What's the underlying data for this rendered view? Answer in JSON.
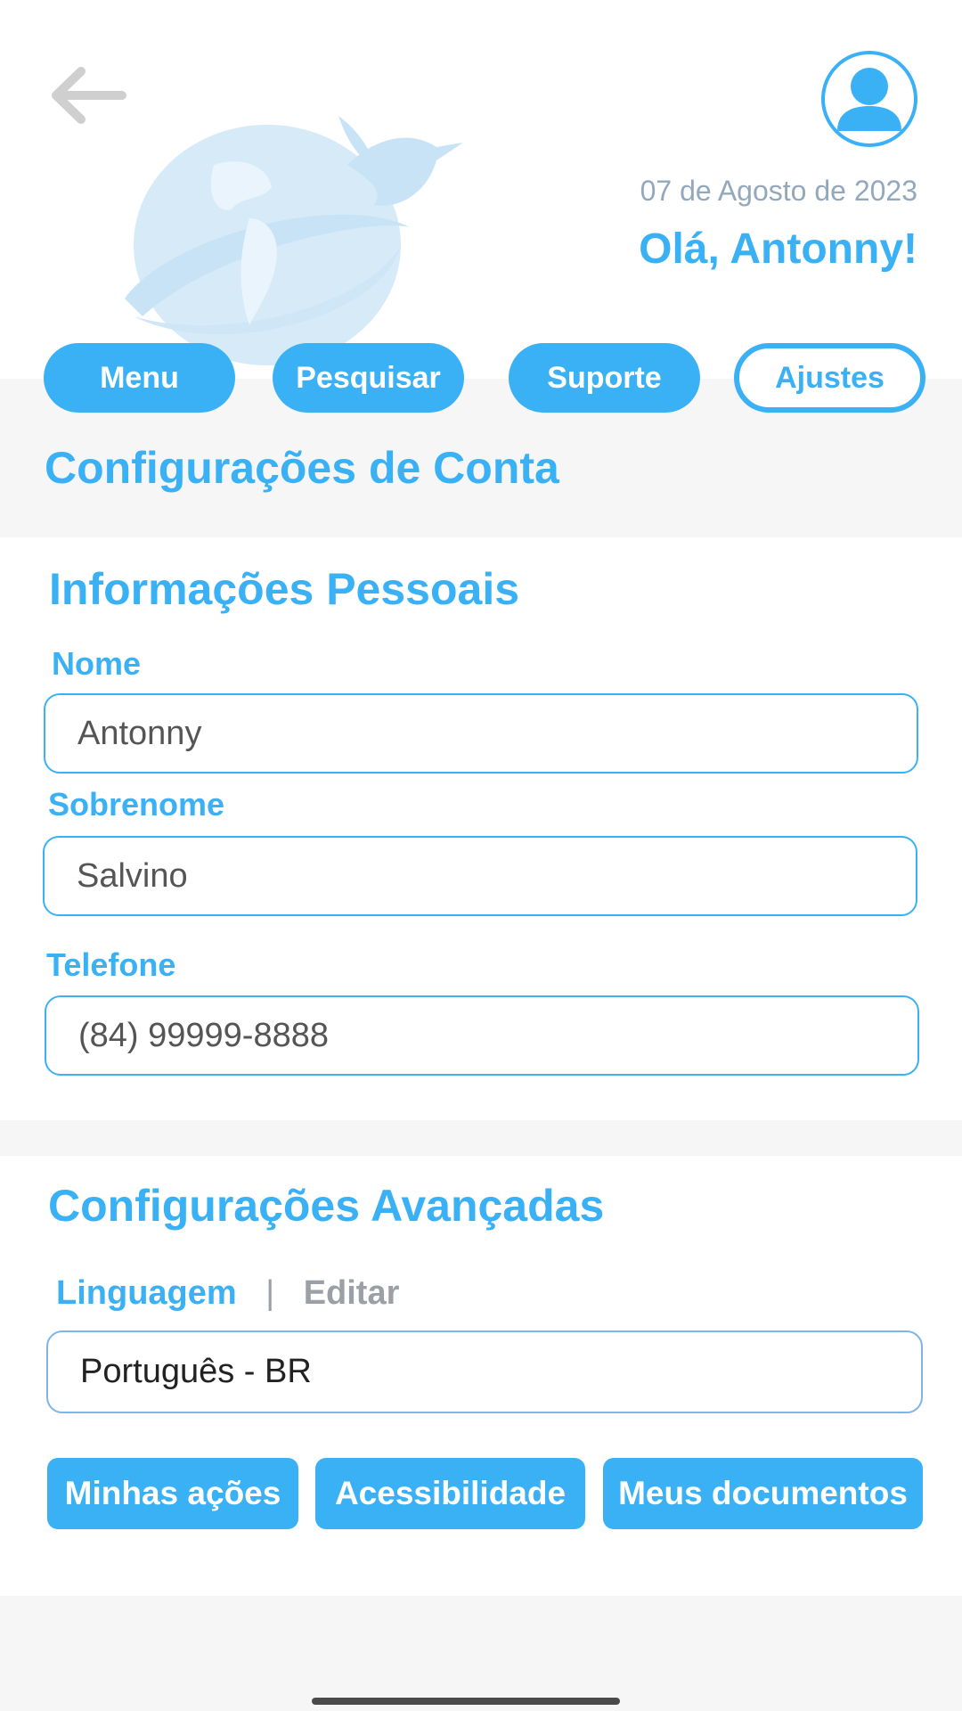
{
  "header": {
    "date": "07 de Agosto de 2023",
    "greeting": "Olá, Antonny!"
  },
  "nav": {
    "items": [
      {
        "label": "Menu",
        "active": false
      },
      {
        "label": "Pesquisar",
        "active": false
      },
      {
        "label": "Suporte",
        "active": false
      },
      {
        "label": "Ajustes",
        "active": true
      }
    ]
  },
  "page": {
    "title": "Configurações de Conta"
  },
  "personal": {
    "title": "Informações Pessoais",
    "name_label": "Nome",
    "name_value": "Antonny",
    "surname_label": "Sobrenome",
    "surname_value": "Salvino",
    "phone_label": "Telefone",
    "phone_value": "(84) 99999-8888"
  },
  "advanced": {
    "title": "Configurações Avançadas",
    "language_label": "Linguagem",
    "separator": "|",
    "edit_label": "Editar",
    "language_value": "Português - BR",
    "actions": [
      "Minhas ações",
      "Acessibilidade",
      "Meus documentos"
    ]
  },
  "colors": {
    "accent": "#3bb1f5",
    "muted": "#93a8bd",
    "background": "#f6f6f6"
  },
  "icons": {
    "back": "arrow-left-icon",
    "avatar": "user-avatar-icon",
    "watermark": "globe-hummingbird-logo"
  }
}
